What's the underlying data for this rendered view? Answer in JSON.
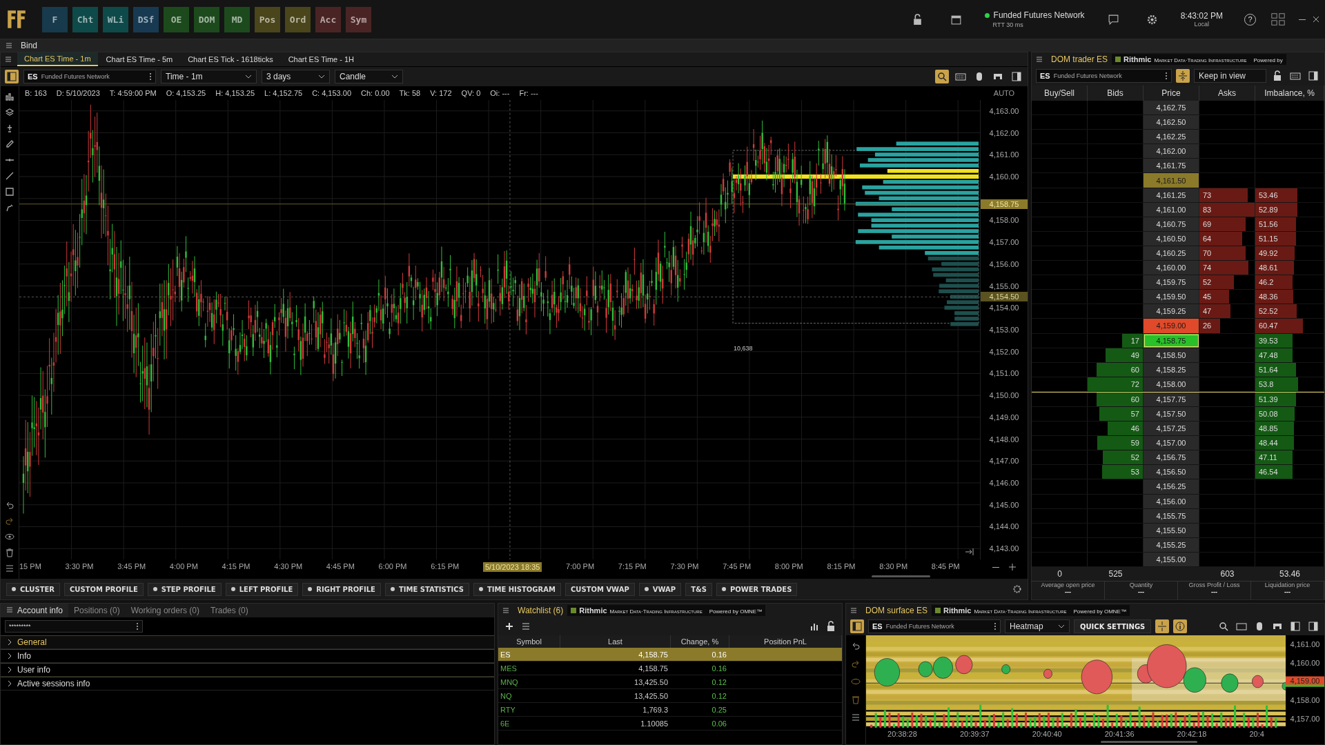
{
  "top_bar": {
    "apps": [
      {
        "label": "F",
        "color": "#173a4c"
      },
      {
        "label": "Cht",
        "color": "#0f4a4a"
      },
      {
        "label": "WLi",
        "color": "#0f4a4a"
      },
      {
        "label": "DSf",
        "color": "#173a52"
      },
      {
        "label": "OE",
        "color": "#1d4a1d"
      },
      {
        "label": "DOM",
        "color": "#1d4a1d"
      },
      {
        "label": "MD",
        "color": "#1d4a1d"
      },
      {
        "label": "Pos",
        "color": "#4a451a"
      },
      {
        "label": "Ord",
        "color": "#4a451a"
      },
      {
        "label": "Acc",
        "color": "#4a2424"
      },
      {
        "label": "Sym",
        "color": "#4a2424"
      }
    ],
    "connection": {
      "name": "Funded Futures Network",
      "rtt": "RTT 30 ms",
      "connected": true
    },
    "clock": {
      "time": "8:43:02 PM",
      "zone": "Local"
    },
    "help": "?"
  },
  "workspace": {
    "title": "Bind"
  },
  "chart": {
    "tabs": [
      {
        "label": "Chart ES Time - 1m",
        "selected": true
      },
      {
        "label": "Chart ES Time - 5m",
        "selected": false
      },
      {
        "label": "Chart ES Tick - 1618ticks",
        "selected": false
      },
      {
        "label": "Chart ES Time - 1H",
        "selected": false
      }
    ],
    "symbol": "ES",
    "account": "Funded Futures Network",
    "timeframe": "Time - 1m",
    "range": "3 days",
    "style": "Candle",
    "info": [
      "B: 163",
      "D: 5/10/2023",
      "T: 4:59:00 PM",
      "O: 4,153.25",
      "H: 4,153.25",
      "L: 4,152.75",
      "C: 4,153.00",
      "Ch: 0.00",
      "Tk: 58",
      "V: 172",
      "QV: 0",
      "Oi: ---",
      "Fr: ---"
    ],
    "axis_mode": "AUTO",
    "price_labels": [
      "4,163.00",
      "4,162.00",
      "4,161.00",
      "4,160.00",
      "4,158.00",
      "4,157.00",
      "4,156.00",
      "4,155.00",
      "4,154.00",
      "4,153.00",
      "4,152.00",
      "4,151.00",
      "4,150.00",
      "4,149.00",
      "4,148.00",
      "4,147.00",
      "4,146.00",
      "4,145.00",
      "4,144.00",
      "4,143.00"
    ],
    "price_markers": [
      {
        "price": "4,158.75",
        "kind": "last"
      },
      {
        "price": "4,154.50",
        "kind": "cursor"
      }
    ],
    "volume_note": "10,638",
    "time_labels": [
      {
        "label": "15 PM",
        "kind": "tick"
      },
      {
        "label": "3:30 PM",
        "kind": "tick"
      },
      {
        "label": "3:45 PM",
        "kind": "tick"
      },
      {
        "label": "4:00 PM",
        "kind": "tick"
      },
      {
        "label": "4:15 PM",
        "kind": "tick"
      },
      {
        "label": "4:30 PM",
        "kind": "tick"
      },
      {
        "label": "4:45 PM",
        "kind": "tick"
      },
      {
        "label": "6:00 PM",
        "kind": "tick"
      },
      {
        "label": "6:15 PM",
        "kind": "tick"
      },
      {
        "label": "5/10/2023 18:35",
        "kind": "cursor"
      },
      {
        "label": "7:00 PM",
        "kind": "tick"
      },
      {
        "label": "7:15 PM",
        "kind": "tick"
      },
      {
        "label": "7:30 PM",
        "kind": "tick"
      },
      {
        "label": "7:45 PM",
        "kind": "tick"
      },
      {
        "label": "8:00 PM",
        "kind": "tick"
      },
      {
        "label": "8:15 PM",
        "kind": "tick"
      },
      {
        "label": "8:30 PM",
        "kind": "tick"
      },
      {
        "label": "8:45 PM",
        "kind": "tick"
      }
    ],
    "indicators": [
      {
        "label": "CLUSTER",
        "dot": true
      },
      {
        "label": "CUSTOM PROFILE",
        "dot": false
      },
      {
        "label": "STEP PROFILE",
        "dot": true
      },
      {
        "label": "LEFT PROFILE",
        "dot": true
      },
      {
        "label": "RIGHT PROFILE",
        "dot": true
      },
      {
        "label": "TIME STATISTICS",
        "dot": true
      },
      {
        "label": "TIME HISTOGRAM",
        "dot": true
      },
      {
        "label": "CUSTOM VWAP",
        "dot": false
      },
      {
        "label": "VWAP",
        "dot": true
      },
      {
        "label": "T&S",
        "dot": false
      },
      {
        "label": "POWER TRADES",
        "dot": true
      }
    ]
  },
  "dom": {
    "title": "DOM trader ES",
    "brand": "Rithmic",
    "brand_tagline": "Market Data·Trading Infrastructure",
    "powered": "Powered by",
    "symbol": "ES",
    "account": "Funded Futures Network",
    "keep": "Keep in view",
    "columns": [
      "Buy/Sell",
      "Bids",
      "Price",
      "Asks",
      "Imbalance, %"
    ],
    "rows": [
      {
        "price": "4,162.75"
      },
      {
        "price": "4,162.50"
      },
      {
        "price": "4,162.25"
      },
      {
        "price": "4,162.00"
      },
      {
        "price": "4,161.75"
      },
      {
        "price": "4,161.50",
        "color": "#8a7a2a"
      },
      {
        "price": "4,161.25",
        "ask": "73",
        "imbalance": "53.46"
      },
      {
        "price": "4,161.00",
        "ask": "83",
        "imbalance": "52.89"
      },
      {
        "price": "4,160.75",
        "ask": "69",
        "imbalance": "51.56"
      },
      {
        "price": "4,160.50",
        "ask": "64",
        "imbalance": "51.15"
      },
      {
        "price": "4,160.25",
        "ask": "70",
        "imbalance": "49.92"
      },
      {
        "price": "4,160.00",
        "ask": "74",
        "imbalance": "48.61"
      },
      {
        "price": "4,159.75",
        "ask": "52",
        "imbalance": "46.2"
      },
      {
        "price": "4,159.50",
        "ask": "45",
        "imbalance": "48.36"
      },
      {
        "price": "4,159.25",
        "ask": "47",
        "imbalance": "52.52"
      },
      {
        "price": "4,159.00",
        "ask": "26",
        "imbalance": "60.47",
        "color": "#e04a2a"
      },
      {
        "price": "4,158.75",
        "bid": "17",
        "imbalance": "39.53",
        "color": "#2ac02a"
      },
      {
        "price": "4,158.50",
        "bid": "49",
        "imbalance": "47.48"
      },
      {
        "price": "4,158.25",
        "bid": "60",
        "imbalance": "51.64"
      },
      {
        "price": "4,158.00",
        "bid": "72",
        "imbalance": "53.8"
      },
      {
        "price": "4,157.75",
        "bid": "60",
        "imbalance": "51.39"
      },
      {
        "price": "4,157.50",
        "bid": "57",
        "imbalance": "50.08"
      },
      {
        "price": "4,157.25",
        "bid": "46",
        "imbalance": "48.85"
      },
      {
        "price": "4,157.00",
        "bid": "59",
        "imbalance": "48.44"
      },
      {
        "price": "4,156.75",
        "bid": "52",
        "imbalance": "47.11"
      },
      {
        "price": "4,156.50",
        "bid": "53",
        "imbalance": "46.54"
      },
      {
        "price": "4,156.25"
      },
      {
        "price": "4,156.00"
      },
      {
        "price": "4,155.75"
      },
      {
        "price": "4,155.50"
      },
      {
        "price": "4,155.25"
      },
      {
        "price": "4,155.00"
      }
    ],
    "totals": {
      "buy_sell": "0",
      "bids": "525",
      "asks": "603",
      "imbalance": "53.46"
    },
    "summary": [
      {
        "label": "Average open price",
        "value": "---"
      },
      {
        "label": "Quantity",
        "value": "---"
      },
      {
        "label": "Gross Profit / Loss",
        "value": "---"
      },
      {
        "label": "Liquidation price",
        "value": "---"
      }
    ]
  },
  "account": {
    "tabs": [
      {
        "label": "Account info",
        "selected": true
      },
      {
        "label": "Positions (0)",
        "selected": false
      },
      {
        "label": "Working orders (0)",
        "selected": false
      },
      {
        "label": "Trades (0)",
        "selected": false
      }
    ],
    "account_value": "*********",
    "sections": [
      {
        "label": "General",
        "selected": true
      },
      {
        "label": "Info",
        "selected": false
      },
      {
        "label": "User info",
        "selected": false
      },
      {
        "label": "Active sessions info",
        "selected": false
      }
    ]
  },
  "watchlist": {
    "title": "Watchlist (6)",
    "brand": "Rithmic",
    "brand_tagline": "Market Data·Trading Infrastructure",
    "powered": "Powered by OMNE™",
    "columns": [
      "Symbol",
      "Last",
      "Change, %",
      "Position PnL"
    ],
    "rows": [
      {
        "symbol": "ES",
        "last": "4,158.75",
        "change": "0.16",
        "selected": true
      },
      {
        "symbol": "MES",
        "last": "4,158.75",
        "change": "0.16",
        "selected": false
      },
      {
        "symbol": "MNQ",
        "last": "13,425.50",
        "change": "0.12",
        "selected": false
      },
      {
        "symbol": "NQ",
        "last": "13,425.50",
        "change": "0.12",
        "selected": false
      },
      {
        "symbol": "RTY",
        "last": "1,769.3",
        "change": "0.25",
        "selected": false
      },
      {
        "symbol": "6E",
        "last": "1.10085",
        "change": "0.06",
        "selected": false
      }
    ]
  },
  "surface": {
    "title": "DOM surface ES",
    "brand": "Rithmic",
    "brand_tagline": "Market Data·Trading Infrastructure",
    "powered": "Powered by OMNE™",
    "symbol": "ES",
    "account": "Funded Futures Network",
    "mode": "Heatmap",
    "quick": "QUICK SETTINGS",
    "price_labels": [
      "4,161.00",
      "4,160.00",
      "4,158.00",
      "4,157.00"
    ],
    "price_marker": "4,159.00",
    "time_labels": [
      "20:38:28",
      "20:39:37",
      "20:40:40",
      "20:41:36",
      "20:42:18",
      "20:4"
    ]
  }
}
